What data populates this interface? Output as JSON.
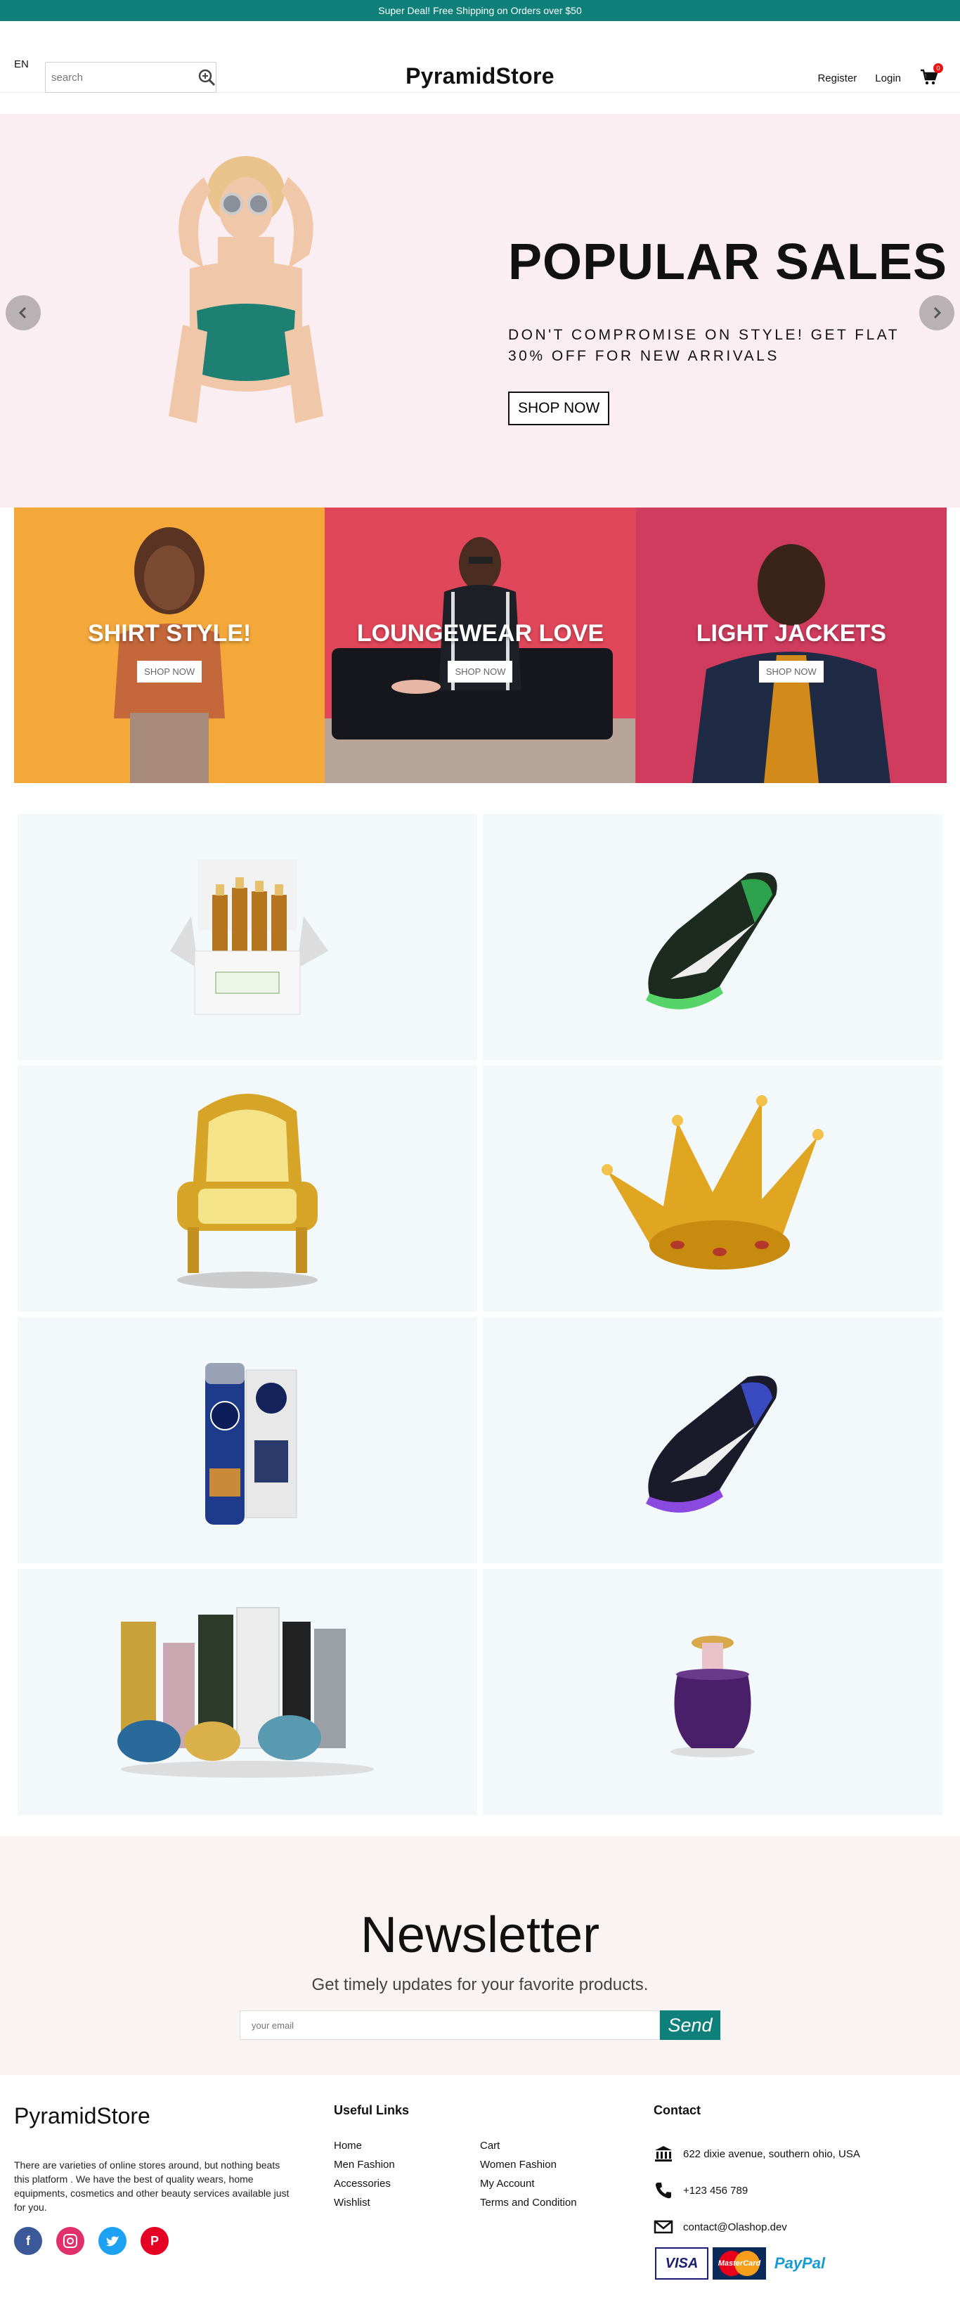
{
  "announcement": "Super Deal! Free Shipping on Orders over $50",
  "header": {
    "lang": "EN",
    "search_placeholder": "search",
    "brand": "PyramidStore",
    "register": "Register",
    "login": "Login",
    "cart_count": "0"
  },
  "hero": {
    "title": "POPULAR SALES",
    "subtitle": "DON'T COMPROMISE ON STYLE! GET FLAT 30% OFF FOR NEW ARRIVALS",
    "button": "SHOP NOW"
  },
  "categories": [
    {
      "title": "SHIRT STYLE!",
      "button": "SHOP NOW",
      "bg": "#f4a83a"
    },
    {
      "title": "LOUNGEWEAR LOVE",
      "button": "SHOP NOW",
      "bg": "#e0475a"
    },
    {
      "title": "LIGHT JACKETS",
      "button": "SHOP NOW",
      "bg": "#cf3c5e"
    }
  ],
  "products": [
    "oil-bottles-box",
    "green-sneaker",
    "golden-armchair",
    "golden-crown",
    "nivea-deodorant",
    "purple-sneaker",
    "perfume-collection",
    "purple-perfume"
  ],
  "newsletter": {
    "title": "Newsletter",
    "subtitle": "Get timely updates for your favorite products.",
    "placeholder": "your email",
    "button": "Send"
  },
  "footer": {
    "brand": "PyramidStore",
    "about": "There are varieties of online stores around, but nothing beats this platform . We have the best of quality wears, home equipments, cosmetics and other beauty services available just for you.",
    "useful_links_title": "Useful Links",
    "links": [
      "Home",
      "Cart",
      "Men Fashion",
      "Women Fashion",
      "Accessories",
      "My Account",
      "Wishlist",
      "Terms and Condition"
    ],
    "contact_title": "Contact",
    "address": "622 dixie avenue, southern ohio, USA",
    "phone": "+123 456 789",
    "email": "contact@Olashop.dev",
    "payments": [
      "VISA",
      "MasterCard",
      "PayPal"
    ]
  },
  "colors": {
    "accent": "#0e8079",
    "hero_bg": "#fbeef2",
    "tile_bg": "#f3f8fb",
    "newsletter_bg": "#faf3f3"
  }
}
